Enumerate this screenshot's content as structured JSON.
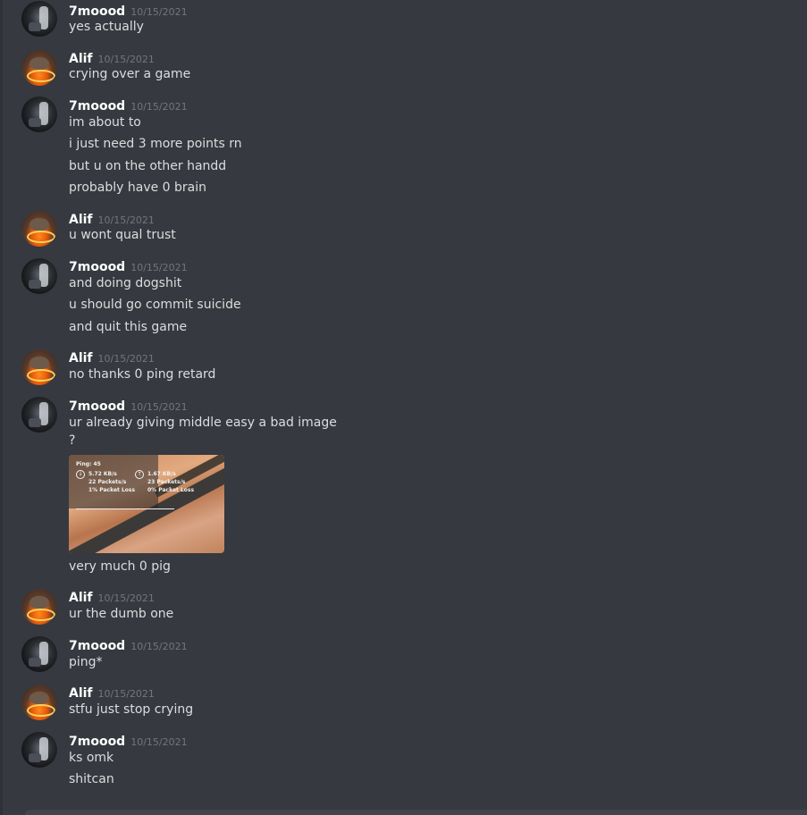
{
  "messages": [
    {
      "author": "7moood",
      "avatar": "dark-avatar",
      "time": "10/15/2021",
      "lines": [
        "yes actually"
      ]
    },
    {
      "author": "Alif",
      "avatar": "fire-avatar",
      "time": "10/15/2021",
      "lines": [
        "crying over a game"
      ]
    },
    {
      "author": "7moood",
      "avatar": "dark-avatar",
      "time": "10/15/2021",
      "lines": [
        "im about to",
        "i just need 3 more points rn",
        "but u on the other handd",
        "probably have 0 brain"
      ]
    },
    {
      "author": "Alif",
      "avatar": "fire-avatar",
      "time": "10/15/2021",
      "lines": [
        "u wont qual trust"
      ]
    },
    {
      "author": "7moood",
      "avatar": "dark-avatar",
      "time": "10/15/2021",
      "lines": [
        "and doing dogshit",
        "u should go commit suicide",
        "and quit this game"
      ]
    },
    {
      "author": "Alif",
      "avatar": "fire-avatar",
      "time": "10/15/2021",
      "lines": [
        "no thanks 0 ping retard"
      ]
    },
    {
      "author": "7moood",
      "avatar": "dark-avatar",
      "time": "10/15/2021",
      "lines": [
        "ur already giving middle easy a bad image",
        "?"
      ],
      "attachment": {
        "ping": "Ping: 45",
        "down_rate": "5.72 KB/s",
        "down_packets": "22 Packets/s",
        "down_loss": "1% Packet Loss",
        "up_rate": "1.67 KB/s",
        "up_packets": "23 Packets/s",
        "up_loss": "0% Packet Loss"
      },
      "after_attachment": "very much 0 pig"
    },
    {
      "author": "Alif",
      "avatar": "fire-avatar",
      "time": "10/15/2021",
      "lines": [
        "ur the dumb one"
      ]
    },
    {
      "author": "7moood",
      "avatar": "dark-avatar",
      "time": "10/15/2021",
      "lines": [
        "ping*"
      ]
    },
    {
      "author": "Alif",
      "avatar": "fire-avatar",
      "time": "10/15/2021",
      "lines": [
        "stfu just stop crying"
      ]
    },
    {
      "author": "7moood",
      "avatar": "dark-avatar",
      "time": "10/15/2021",
      "lines": [
        "ks omk",
        "shitcan"
      ]
    }
  ],
  "colors": {
    "background": "#36393f",
    "username": "#ffffff",
    "timestamp": "#72767d",
    "message_text": "#dcddde"
  }
}
